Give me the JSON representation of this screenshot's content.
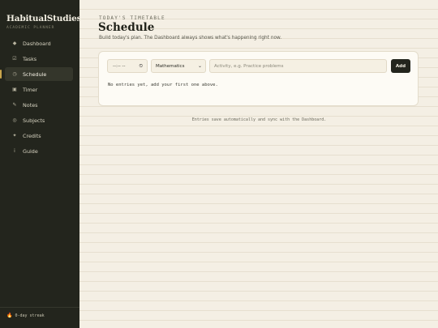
{
  "brand": {
    "name": "HabitualStudies",
    "dot": ".",
    "tagline": "ACADEMIC PLANNER"
  },
  "sidebar": {
    "items": [
      {
        "icon": "diamond-icon",
        "glyph": "◆",
        "label": "Dashboard",
        "active": false
      },
      {
        "icon": "checkbox-icon",
        "glyph": "☑",
        "label": "Tasks",
        "active": false
      },
      {
        "icon": "clock-icon",
        "glyph": "◷",
        "label": "Schedule",
        "active": true
      },
      {
        "icon": "timer-icon",
        "glyph": "▣",
        "label": "Timer",
        "active": false
      },
      {
        "icon": "pencil-icon",
        "glyph": "✎",
        "label": "Notes",
        "active": false
      },
      {
        "icon": "target-icon",
        "glyph": "◎",
        "label": "Subjects",
        "active": false
      },
      {
        "icon": "star-icon",
        "glyph": "✦",
        "label": "Credits",
        "active": false
      },
      {
        "icon": "info-icon",
        "glyph": "i",
        "label": "Guide",
        "active": false
      }
    ],
    "streak": {
      "icon": "fire-icon",
      "glyph": "🔥",
      "text": "0-day streak"
    }
  },
  "page": {
    "eyebrow": "TODAY'S TIMETABLE",
    "title": "Schedule",
    "subtitle": "Build today's plan. The Dashboard always shows what's happening right now."
  },
  "form": {
    "time": {
      "value": "--:-- --",
      "icon": "clock-icon",
      "glyph": "⏲"
    },
    "subject": {
      "value": "Mathematics",
      "icon": "chevron-down-icon",
      "glyph": "⌄"
    },
    "activity": {
      "value": "",
      "placeholder": "Activity, e.g. Practice problems"
    },
    "add_label": "Add"
  },
  "empty_message": "No entries yet, add your first one above.",
  "footer_note": "Entries save automatically and sync with the Dashboard.",
  "colors": {
    "sidebar_bg": "#23251d",
    "page_bg": "#f4efe4",
    "accent": "#c9a54c",
    "button_bg": "#23251d"
  }
}
